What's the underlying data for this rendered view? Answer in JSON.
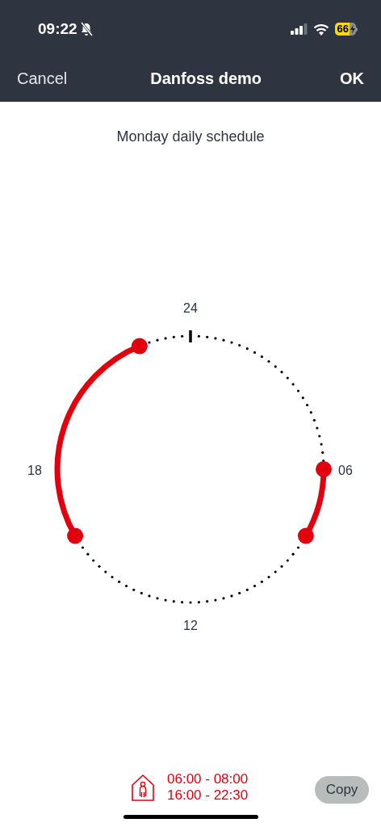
{
  "status_bar": {
    "time": "09:22",
    "battery": "66"
  },
  "nav": {
    "cancel": "Cancel",
    "title": "Danfoss demo",
    "confirm": "OK"
  },
  "schedule": {
    "title": "Monday daily schedule",
    "dial_labels": [
      "24",
      "06",
      "12",
      "18"
    ],
    "periods": [
      {
        "text": "06:00 - 08:00"
      },
      {
        "text": "16:00 - 22:30"
      }
    ]
  },
  "copy_button": "Copy"
}
